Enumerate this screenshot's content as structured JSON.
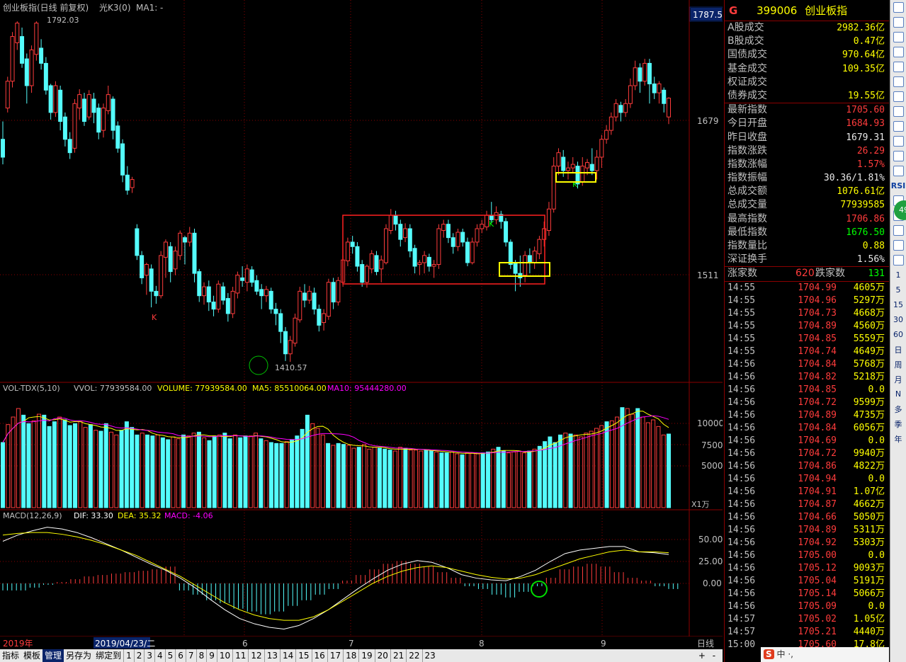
{
  "main_chart": {
    "title": "创业板指(日线 前复权)",
    "indicator": "光K3(0)",
    "ma": "MA1: -",
    "top_price": "1787.5",
    "high_label": "1792.03",
    "low_label": "1410.57",
    "axis_labels": [
      "1679",
      "1511"
    ],
    "markers": [
      "K",
      "K",
      "K"
    ]
  },
  "volume_panel": {
    "name": "VOL-TDX(5,10)",
    "vvol": "VVOL: 77939584.00",
    "volume": "VOLUME: 77939584.00",
    "ma5": "MA5: 85510064.00",
    "ma10": "MA10: 95444280.00",
    "axis_labels": [
      "10000",
      "7500",
      "5000"
    ],
    "unit": "X1万"
  },
  "macd_panel": {
    "name": "MACD(12,26,9)",
    "dif": "DIF: 33.30",
    "dea": "DEA: 35.32",
    "macd": "MACD: -4.06",
    "axis_labels": [
      "50.00",
      "25.00",
      "0.00"
    ]
  },
  "date_axis": {
    "year": "2019年",
    "selected": "2019/04/23/二",
    "months": [
      "6",
      "7",
      "8",
      "9"
    ],
    "period": "日线",
    "buttons": [
      "+",
      "-"
    ]
  },
  "chart_data": {
    "type": "candlestick",
    "title": "创业板指(日线 前复权)",
    "ylim": [
      1400,
      1800
    ],
    "high": 1792.03,
    "low": 1410.57,
    "candles": [
      [
        1660,
        1640,
        1680,
        1632
      ],
      [
        1695,
        1725,
        1730,
        1690
      ],
      [
        1725,
        1775,
        1780,
        1718
      ],
      [
        1768,
        1790,
        1792,
        1760
      ],
      [
        1775,
        1745,
        1785,
        1740
      ],
      [
        1750,
        1720,
        1756,
        1700
      ],
      [
        1720,
        1760,
        1765,
        1712
      ],
      [
        1755,
        1790,
        1792,
        1748
      ],
      [
        1762,
        1745,
        1772,
        1738
      ],
      [
        1745,
        1715,
        1752,
        1710
      ],
      [
        1720,
        1690,
        1722,
        1682
      ],
      [
        1690,
        1720,
        1725,
        1685
      ],
      [
        1715,
        1680,
        1720,
        1670
      ],
      [
        1685,
        1660,
        1690,
        1652
      ],
      [
        1660,
        1645,
        1668,
        1638
      ],
      [
        1650,
        1700,
        1705,
        1645
      ],
      [
        1695,
        1710,
        1716,
        1682
      ],
      [
        1705,
        1680,
        1712,
        1675
      ],
      [
        1685,
        1710,
        1715,
        1682
      ],
      [
        1705,
        1690,
        1712,
        1678
      ],
      [
        1695,
        1668,
        1700,
        1660
      ],
      [
        1670,
        1695,
        1700,
        1662
      ],
      [
        1692,
        1710,
        1720,
        1688
      ],
      [
        1705,
        1670,
        1708,
        1660
      ],
      [
        1675,
        1650,
        1680,
        1645
      ],
      [
        1655,
        1620,
        1660,
        1612
      ],
      [
        1620,
        1603,
        1630,
        1598
      ],
      [
        1606,
        1615,
        1618,
        1600
      ],
      [
        1560,
        1530,
        1565,
        1525
      ],
      [
        1530,
        1505,
        1535,
        1498
      ],
      [
        1508,
        1520,
        1522,
        1486
      ],
      [
        1515,
        1490,
        1520,
        1472
      ],
      [
        1490,
        1485,
        1496,
        1476
      ],
      [
        1485,
        1530,
        1535,
        1482
      ],
      [
        1528,
        1545,
        1548,
        1505
      ],
      [
        1540,
        1512,
        1545,
        1500
      ],
      [
        1515,
        1535,
        1540,
        1508
      ],
      [
        1530,
        1555,
        1558,
        1525
      ],
      [
        1550,
        1545,
        1552,
        1520
      ],
      [
        1545,
        1555,
        1562,
        1540
      ],
      [
        1555,
        1510,
        1560,
        1500
      ],
      [
        1512,
        1485,
        1515,
        1478
      ],
      [
        1485,
        1495,
        1500,
        1475
      ],
      [
        1495,
        1478,
        1502,
        1468
      ],
      [
        1478,
        1470,
        1485,
        1462
      ],
      [
        1470,
        1498,
        1502,
        1466
      ],
      [
        1495,
        1480,
        1500,
        1475
      ],
      [
        1482,
        1465,
        1488,
        1456
      ],
      [
        1465,
        1490,
        1495,
        1460
      ],
      [
        1488,
        1508,
        1512,
        1482
      ],
      [
        1505,
        1502,
        1518,
        1495
      ],
      [
        1500,
        1515,
        1520,
        1490
      ],
      [
        1514,
        1500,
        1518,
        1495
      ],
      [
        1502,
        1490,
        1508,
        1486
      ],
      [
        1492,
        1485,
        1498,
        1470
      ],
      [
        1485,
        1492,
        1496,
        1478
      ],
      [
        1490,
        1470,
        1494,
        1465
      ],
      [
        1470,
        1465,
        1477,
        1452
      ],
      [
        1465,
        1445,
        1470,
        1432
      ],
      [
        1445,
        1420,
        1450,
        1412
      ],
      [
        1420,
        1435,
        1440,
        1411
      ],
      [
        1432,
        1460,
        1465,
        1428
      ],
      [
        1458,
        1490,
        1495,
        1455
      ],
      [
        1488,
        1480,
        1498,
        1472
      ],
      [
        1480,
        1490,
        1496,
        1476
      ],
      [
        1488,
        1470,
        1494,
        1464
      ],
      [
        1470,
        1452,
        1475,
        1445
      ],
      [
        1455,
        1465,
        1470,
        1446
      ],
      [
        1462,
        1500,
        1504,
        1458
      ],
      [
        1500,
        1478,
        1505,
        1470
      ],
      [
        1478,
        1502,
        1506,
        1474
      ],
      [
        1500,
        1525,
        1530,
        1495
      ],
      [
        1524,
        1545,
        1550,
        1518
      ],
      [
        1545,
        1540,
        1552,
        1532
      ],
      [
        1540,
        1518,
        1545,
        1512
      ],
      [
        1520,
        1500,
        1525,
        1495
      ],
      [
        1500,
        1518,
        1520,
        1494
      ],
      [
        1515,
        1532,
        1536,
        1510
      ],
      [
        1530,
        1512,
        1535,
        1508
      ],
      [
        1515,
        1525,
        1530,
        1500
      ],
      [
        1522,
        1560,
        1565,
        1520
      ],
      [
        1558,
        1575,
        1582,
        1554
      ],
      [
        1575,
        1565,
        1580,
        1558
      ],
      [
        1565,
        1548,
        1570,
        1540
      ],
      [
        1550,
        1560,
        1566,
        1545
      ],
      [
        1560,
        1535,
        1565,
        1528
      ],
      [
        1538,
        1518,
        1542,
        1510
      ],
      [
        1520,
        1522,
        1525,
        1508
      ],
      [
        1522,
        1530,
        1535,
        1510
      ],
      [
        1528,
        1518,
        1532,
        1512
      ],
      [
        1518,
        1520,
        1525,
        1505
      ],
      [
        1520,
        1560,
        1565,
        1515
      ],
      [
        1558,
        1565,
        1570,
        1550
      ],
      [
        1565,
        1550,
        1570,
        1544
      ],
      [
        1550,
        1540,
        1555,
        1532
      ],
      [
        1540,
        1556,
        1560,
        1535
      ],
      [
        1556,
        1545,
        1560,
        1540
      ],
      [
        1545,
        1522,
        1550,
        1518
      ],
      [
        1522,
        1545,
        1550,
        1520
      ],
      [
        1545,
        1560,
        1565,
        1540
      ],
      [
        1560,
        1565,
        1570,
        1555
      ],
      [
        1562,
        1575,
        1580,
        1558
      ],
      [
        1575,
        1570,
        1590,
        1566
      ],
      [
        1570,
        1578,
        1585,
        1565
      ],
      [
        1576,
        1568,
        1580,
        1560
      ],
      [
        1568,
        1545,
        1572,
        1540
      ],
      [
        1545,
        1520,
        1548,
        1515
      ],
      [
        1522,
        1510,
        1525,
        1490
      ],
      [
        1510,
        1505,
        1530,
        1495
      ],
      [
        1508,
        1530,
        1535,
        1500
      ],
      [
        1530,
        1522,
        1538,
        1510
      ],
      [
        1522,
        1535,
        1540,
        1515
      ],
      [
        1532,
        1548,
        1552,
        1526
      ],
      [
        1548,
        1560,
        1568,
        1540
      ],
      [
        1558,
        1582,
        1590,
        1552
      ],
      [
        1582,
        1630,
        1640,
        1578
      ],
      [
        1630,
        1645,
        1650,
        1620
      ],
      [
        1640,
        1625,
        1648,
        1618
      ],
      [
        1625,
        1628,
        1635,
        1615
      ],
      [
        1628,
        1632,
        1640,
        1622
      ],
      [
        1630,
        1610,
        1635,
        1605
      ],
      [
        1612,
        1630,
        1640,
        1608
      ],
      [
        1628,
        1634,
        1638,
        1620
      ],
      [
        1632,
        1625,
        1650,
        1620
      ],
      [
        1625,
        1640,
        1648,
        1615
      ],
      [
        1640,
        1660,
        1665,
        1628
      ],
      [
        1660,
        1670,
        1676,
        1655
      ],
      [
        1670,
        1685,
        1690,
        1665
      ],
      [
        1685,
        1700,
        1705,
        1680
      ],
      [
        1698,
        1690,
        1702,
        1680
      ],
      [
        1690,
        1700,
        1705,
        1685
      ],
      [
        1700,
        1720,
        1728,
        1695
      ],
      [
        1720,
        1740,
        1748,
        1715
      ],
      [
        1740,
        1725,
        1745,
        1712
      ],
      [
        1725,
        1745,
        1750,
        1720
      ],
      [
        1745,
        1722,
        1750,
        1700
      ],
      [
        1722,
        1712,
        1730,
        1705
      ],
      [
        1712,
        1722,
        1725,
        1700
      ],
      [
        1715,
        1700,
        1718,
        1690
      ],
      [
        1685,
        1706,
        1707,
        1677
      ]
    ],
    "volume": [
      6900,
      8800,
      9600,
      10500,
      9800,
      8900,
      9200,
      9900,
      9800,
      8600,
      9100,
      9600,
      9300,
      8700,
      8900,
      9100,
      8500,
      8800,
      8200,
      8100,
      8900,
      8000,
      7700,
      8200,
      9100,
      8500,
      7700,
      7900,
      7700,
      7600,
      7700,
      7400,
      7200,
      7500,
      7300,
      7700,
      7600,
      7900,
      8000,
      7400,
      7100,
      7600,
      7700,
      7900,
      7300,
      7700,
      7400,
      7600,
      7600,
      7900,
      7300,
      7100,
      6900,
      6800,
      6800,
      7000,
      7200,
      7600,
      8300,
      9800,
      8900,
      8400,
      7700,
      6800,
      6600,
      6800,
      6700,
      6600,
      6300,
      6400,
      6700,
      6200,
      6400,
      6300,
      6200,
      6100,
      6000,
      6400,
      6300,
      6100,
      6100,
      6000,
      6100,
      6000,
      5900,
      5800,
      5800,
      5900,
      5700,
      5600,
      5800,
      5800,
      5700,
      5800,
      5900,
      6200,
      6400,
      6000,
      5800,
      5900,
      6000,
      5800,
      6000,
      6200,
      6500,
      7000,
      7500,
      6900,
      7700,
      7900,
      7800,
      7700,
      7500,
      7900,
      8100,
      8400,
      8700,
      9100,
      9200,
      9600,
      10600,
      10500,
      9900,
      10500,
      9600,
      9000,
      9300,
      8600,
      7700,
      7800
    ],
    "macd": {
      "dif": [
        48,
        55,
        60,
        64,
        62,
        58,
        52,
        45,
        38,
        30,
        22,
        15,
        6,
        -5,
        -18,
        -30,
        -40,
        -46,
        -50,
        -52,
        -48,
        -40,
        -30,
        -18,
        -6,
        5,
        15,
        22,
        26,
        24,
        18,
        10,
        6,
        4,
        3,
        8,
        15,
        25,
        34,
        38,
        40,
        42,
        42,
        36,
        35,
        33
      ],
      "dea": [
        55,
        57,
        58,
        58,
        56,
        53,
        49,
        44,
        38,
        32,
        24,
        16,
        8,
        -2,
        -12,
        -22,
        -30,
        -36,
        -40,
        -42,
        -42,
        -38,
        -30,
        -20,
        -10,
        0,
        8,
        14,
        18,
        20,
        18,
        14,
        10,
        7,
        5,
        6,
        10,
        16,
        22,
        28,
        32,
        36,
        38,
        36,
        36,
        35
      ],
      "histogram": [
        -5,
        -5,
        -3,
        -1,
        1,
        3,
        5,
        6,
        7,
        8,
        9,
        10,
        12,
        -5,
        -8,
        -12,
        -14,
        -18,
        -20,
        -22,
        -20,
        -16,
        -12,
        -8,
        -4,
        2,
        6,
        10,
        14,
        16,
        14,
        12,
        8,
        4,
        -2,
        -4,
        -8,
        -10,
        -6,
        -2,
        4,
        10,
        12,
        14,
        12,
        8,
        4,
        2,
        -2,
        -4
      ]
    }
  },
  "quote": {
    "flag": "G",
    "code": "399006",
    "name": "创业板指",
    "rows": [
      {
        "label": "A股成交",
        "value": "2982.36亿",
        "cls": "y"
      },
      {
        "label": "B股成交",
        "value": "0.47亿",
        "cls": "y"
      },
      {
        "label": "国债成交",
        "value": "970.64亿",
        "cls": "y"
      },
      {
        "label": "基金成交",
        "value": "109.35亿",
        "cls": "y"
      },
      {
        "label": "权证成交",
        "value": "",
        "cls": "y"
      },
      {
        "label": "债券成交",
        "value": "19.55亿",
        "cls": "y"
      }
    ],
    "index_rows": [
      {
        "label": "最新指数",
        "value": "1705.60",
        "cls": "r"
      },
      {
        "label": "今日开盘",
        "value": "1684.93",
        "cls": "r"
      },
      {
        "label": "昨日收盘",
        "value": "1679.31",
        "cls": "w"
      },
      {
        "label": "指数涨跌",
        "value": "26.29",
        "cls": "r"
      },
      {
        "label": "指数涨幅",
        "value": "1.57%",
        "cls": "r"
      },
      {
        "label": "指数振幅",
        "value": "30.36/1.81%",
        "cls": "w"
      },
      {
        "label": "总成交额",
        "value": "1076.61亿",
        "cls": "y"
      },
      {
        "label": "总成交量",
        "value": "77939585",
        "cls": "y"
      },
      {
        "label": "最高指数",
        "value": "1706.86",
        "cls": "r"
      },
      {
        "label": "最低指数",
        "value": "1676.50",
        "cls": "gr"
      },
      {
        "label": "指数量比",
        "value": "0.88",
        "cls": "y"
      },
      {
        "label": "深证换手",
        "value": "1.56%",
        "cls": "w"
      }
    ],
    "breadth": {
      "up_label": "涨家数",
      "up": "620",
      "down_label": "跌家数",
      "down": "131"
    }
  },
  "ticks": [
    {
      "t": "14:55",
      "p": "1704.99",
      "v": "4605万"
    },
    {
      "t": "14:55",
      "p": "1704.96",
      "v": "5297万"
    },
    {
      "t": "14:55",
      "p": "1704.73",
      "v": "4668万"
    },
    {
      "t": "14:55",
      "p": "1704.89",
      "v": "4560万"
    },
    {
      "t": "14:55",
      "p": "1704.85",
      "v": "5559万"
    },
    {
      "t": "14:55",
      "p": "1704.74",
      "v": "4649万"
    },
    {
      "t": "14:56",
      "p": "1704.84",
      "v": "5768万"
    },
    {
      "t": "14:56",
      "p": "1704.82",
      "v": "5218万"
    },
    {
      "t": "14:56",
      "p": "1704.85",
      "v": "0.0"
    },
    {
      "t": "14:56",
      "p": "1704.72",
      "v": "9599万"
    },
    {
      "t": "14:56",
      "p": "1704.89",
      "v": "4735万"
    },
    {
      "t": "14:56",
      "p": "1704.84",
      "v": "6056万"
    },
    {
      "t": "14:56",
      "p": "1704.69",
      "v": "0.0"
    },
    {
      "t": "14:56",
      "p": "1704.72",
      "v": "9940万"
    },
    {
      "t": "14:56",
      "p": "1704.86",
      "v": "4822万"
    },
    {
      "t": "14:56",
      "p": "1704.94",
      "v": "0.0"
    },
    {
      "t": "14:56",
      "p": "1704.91",
      "v": "1.07亿"
    },
    {
      "t": "14:56",
      "p": "1704.87",
      "v": "4662万"
    },
    {
      "t": "14:56",
      "p": "1704.66",
      "v": "5050万"
    },
    {
      "t": "14:56",
      "p": "1704.89",
      "v": "5311万"
    },
    {
      "t": "14:56",
      "p": "1704.92",
      "v": "5303万"
    },
    {
      "t": "14:56",
      "p": "1705.00",
      "v": "0.0"
    },
    {
      "t": "14:56",
      "p": "1705.12",
      "v": "9093万"
    },
    {
      "t": "14:56",
      "p": "1705.04",
      "v": "5191万"
    },
    {
      "t": "14:56",
      "p": "1705.14",
      "v": "5066万"
    },
    {
      "t": "14:56",
      "p": "1705.09",
      "v": "0.0"
    },
    {
      "t": "14:57",
      "p": "1705.02",
      "v": "1.05亿"
    },
    {
      "t": "14:57",
      "p": "1705.21",
      "v": "4440万"
    },
    {
      "t": "15:00",
      "p": "1705.60",
      "v": "17.8亿"
    }
  ],
  "bottom_tabs": {
    "items": [
      "指标",
      "模板",
      "管理",
      "另存为",
      "绑定到",
      "1",
      "2",
      "3",
      "4",
      "5",
      "6",
      "7",
      "8",
      "9",
      "10",
      "11",
      "12",
      "13",
      "14",
      "15",
      "16",
      "17",
      "18",
      "19",
      "20",
      "21",
      "22",
      "23"
    ],
    "selected": "管理"
  },
  "sidebar": {
    "icons": [
      "up-arrow-icon",
      "down-arrow-icon",
      "window-icon",
      "chart-icon",
      "table-icon",
      "candle-icon",
      "indicator-icon",
      "f10-icon",
      "doc-icon",
      "f2-icon",
      "grid-icon",
      "wave-icon",
      "rsi-icon",
      "dollar-icon",
      "move-icon",
      "pencil-icon",
      "copy-icon",
      "refresh-icon"
    ],
    "labels": [
      "RSI"
    ],
    "periods": [
      "1",
      "5",
      "15",
      "30",
      "60",
      "日",
      "周",
      "月",
      "N",
      "多",
      "季",
      "年"
    ],
    "badge": "49"
  },
  "ime": {
    "logo": "S",
    "text": "中",
    "sym": "·,"
  },
  "colors": {
    "up": "#ff3c3c",
    "down": "#54fcfc",
    "panel_border": "#8b0000",
    "ma5": "#ffff00",
    "ma10": "#ff00ff"
  }
}
